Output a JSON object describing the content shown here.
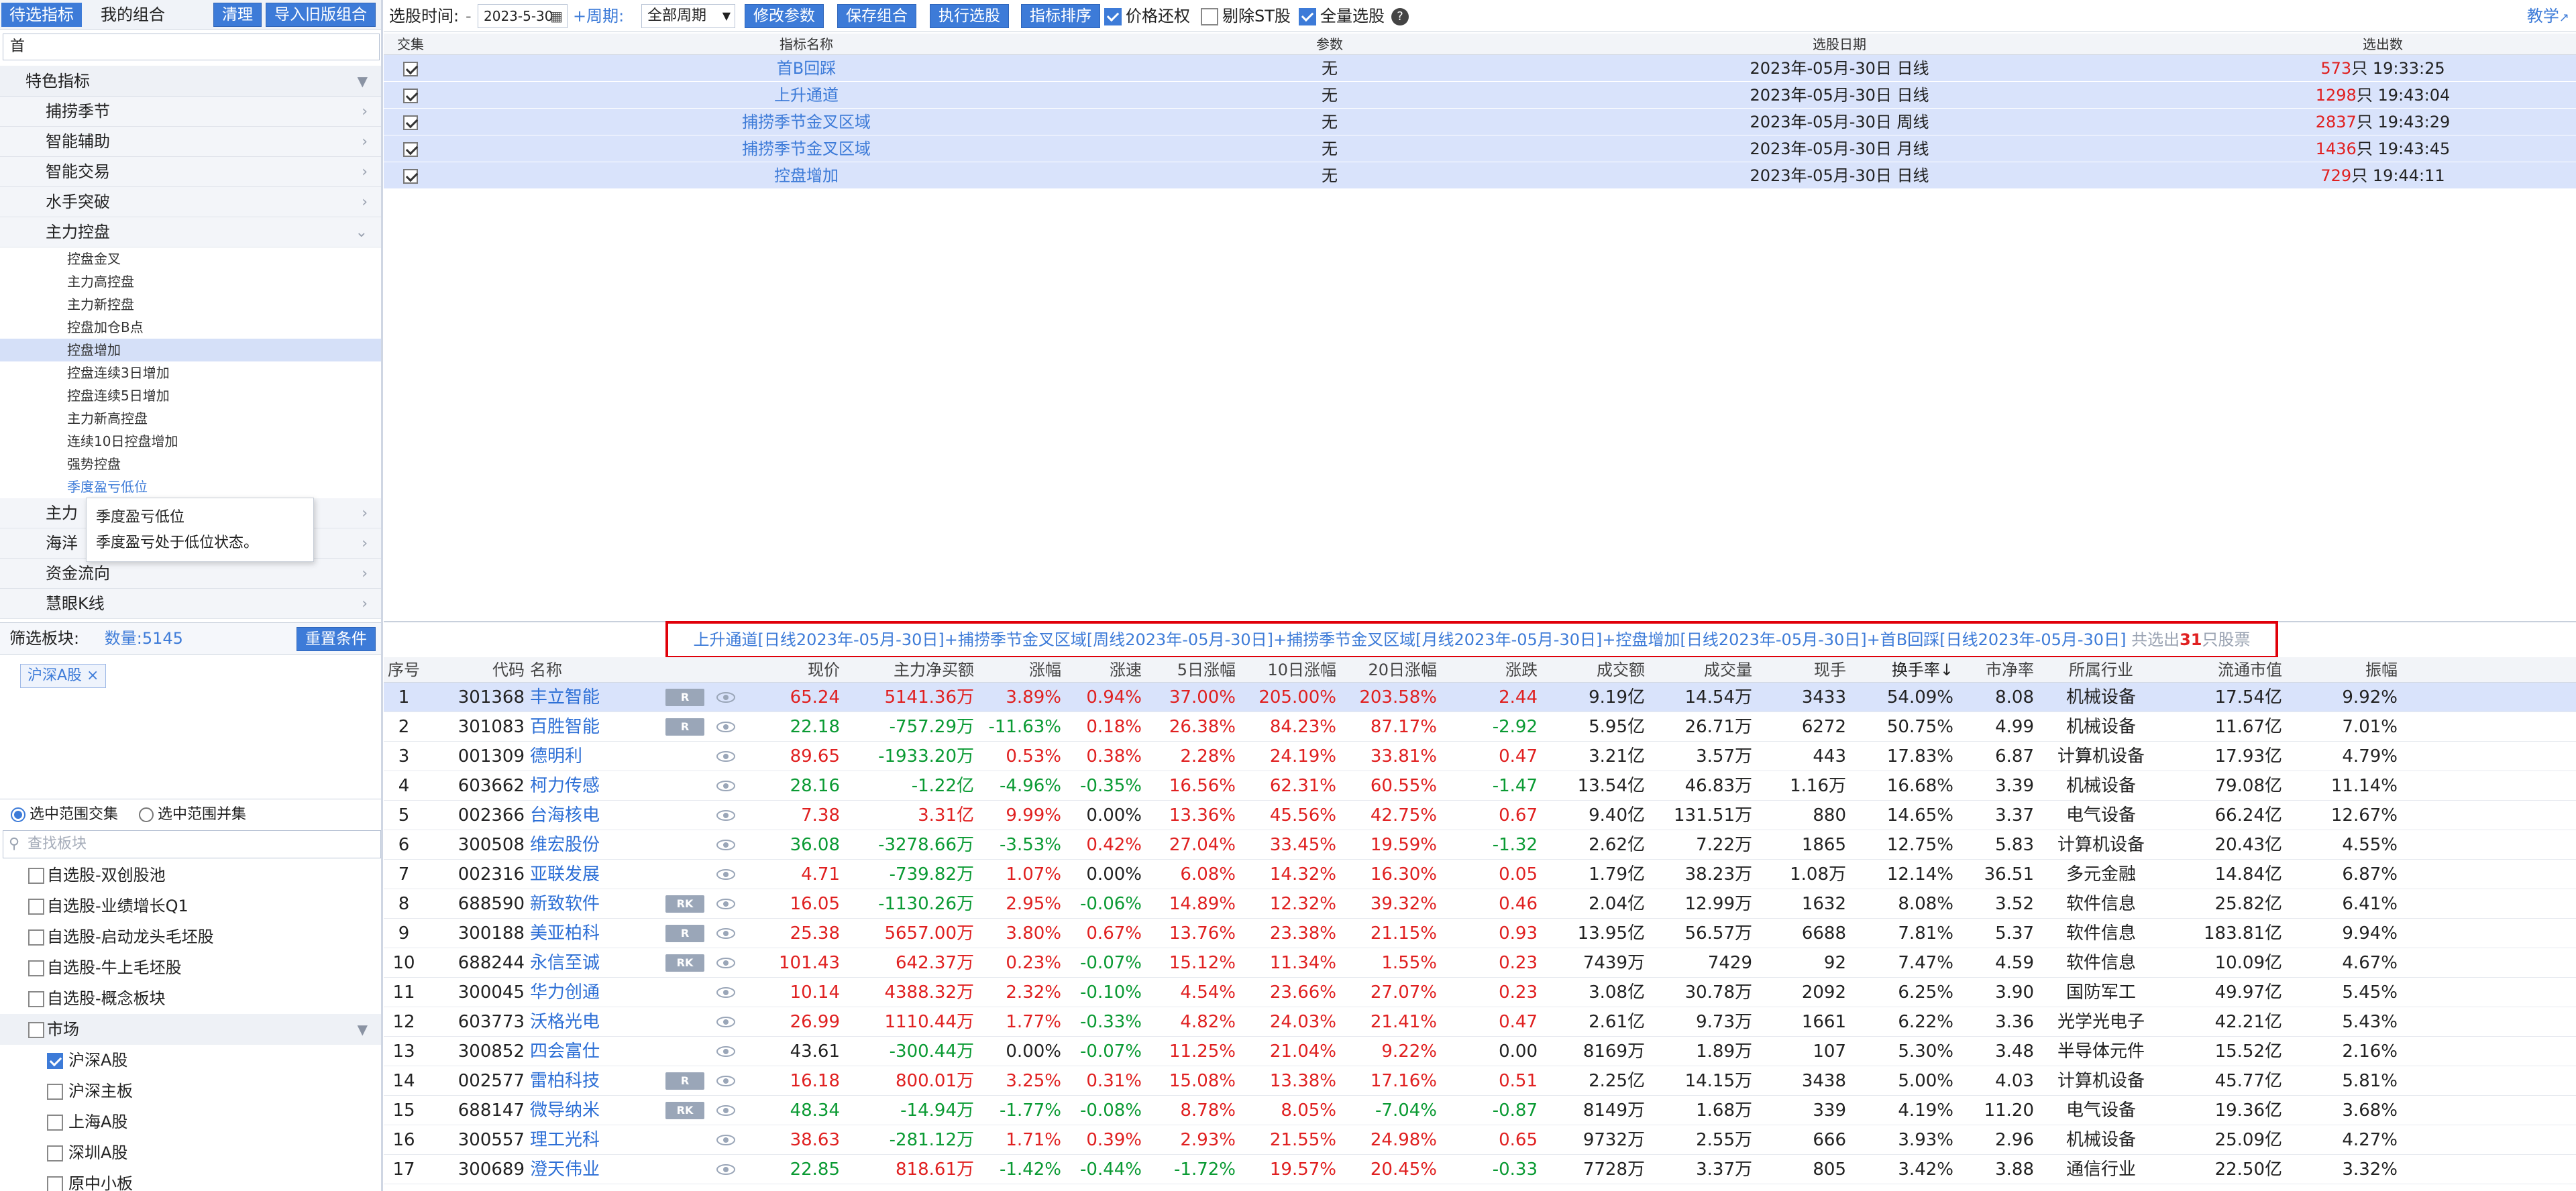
{
  "left": {
    "tabs": [
      "待选指标",
      "我的组合"
    ],
    "buttons": {
      "clear": "清理",
      "import": "导入旧版组合"
    },
    "search_value": "首",
    "tree": [
      {
        "type": "cat",
        "label": "特色指标",
        "arrow": "▼"
      },
      {
        "type": "sub",
        "label": "捕捞季节",
        "arrow": "›"
      },
      {
        "type": "sub",
        "label": "智能辅助",
        "arrow": "›"
      },
      {
        "type": "sub",
        "label": "智能交易",
        "arrow": "›"
      },
      {
        "type": "sub",
        "label": "水手突破",
        "arrow": "›"
      },
      {
        "type": "sub",
        "label": "主力控盘",
        "arrow": "⌄"
      },
      {
        "type": "leaf",
        "label": "控盘金叉"
      },
      {
        "type": "leaf",
        "label": "主力高控盘"
      },
      {
        "type": "leaf",
        "label": "主力新控盘"
      },
      {
        "type": "leaf",
        "label": "控盘加仓B点"
      },
      {
        "type": "leaf",
        "label": "控盘增加",
        "state": "sel"
      },
      {
        "type": "leaf",
        "label": "控盘连续3日增加"
      },
      {
        "type": "leaf",
        "label": "控盘连续5日增加"
      },
      {
        "type": "leaf",
        "label": "主力新高控盘"
      },
      {
        "type": "leaf",
        "label": "连续10日控盘增加"
      },
      {
        "type": "leaf",
        "label": "强势控盘"
      },
      {
        "type": "leaf",
        "label": "季度盈亏低位",
        "state": "hover"
      },
      {
        "type": "sub",
        "label": "主力",
        "arrow": "›"
      },
      {
        "type": "sub",
        "label": "海洋",
        "arrow": "›"
      },
      {
        "type": "sub",
        "label": "资金流向",
        "arrow": "›"
      },
      {
        "type": "sub",
        "label": "慧眼K线",
        "arrow": "›"
      }
    ],
    "tooltip": {
      "title": "季度盈亏低位",
      "desc": "季度盈亏处于低位状态。"
    },
    "filter": {
      "label": "筛选板块:",
      "count": "数量:5145",
      "reset": "重置条件"
    },
    "selected_tag": "沪深A股 ×",
    "radios": {
      "intersect": "选中范围交集",
      "union": "选中范围并集"
    },
    "board_search_placeholder": "查找板块",
    "boards": [
      {
        "type": "item",
        "label": "自选股-双创股池",
        "checked": false
      },
      {
        "type": "item",
        "label": "自选股-业绩增长Q1",
        "checked": false
      },
      {
        "type": "item",
        "label": "自选股-启动龙头毛坯股",
        "checked": false
      },
      {
        "type": "item",
        "label": "自选股-牛上毛坯股",
        "checked": false
      },
      {
        "type": "item",
        "label": "自选股-概念板块",
        "checked": false
      },
      {
        "type": "group",
        "label": "市场",
        "checked": false
      },
      {
        "type": "sub2",
        "label": "沪深A股",
        "checked": true
      },
      {
        "type": "sub2",
        "label": "沪深主板",
        "checked": false
      },
      {
        "type": "sub2",
        "label": "上海A股",
        "checked": false
      },
      {
        "type": "sub2",
        "label": "深圳A股",
        "checked": false
      },
      {
        "type": "sub2",
        "label": "原中小板",
        "checked": false
      }
    ]
  },
  "toolbar": {
    "time_label": "选股时间:",
    "dash": "-",
    "date": "2023-5-30",
    "calendar_icon": "calendar-icon",
    "period_label": "+周期:",
    "period_value": "全部周期",
    "btn_modify": "修改参数",
    "btn_save": "保存组合",
    "btn_run": "执行选股",
    "btn_sort": "指标排序",
    "chk_price": "价格还权",
    "chk_st": "剔除ST股",
    "chk_full": "全量选股",
    "help": "?",
    "teach": "教学"
  },
  "criteria_table": {
    "headers": [
      "交集",
      "指标名称",
      "参数",
      "选股日期",
      "选出数"
    ],
    "rows": [
      {
        "name": "首B回踩",
        "param": "无",
        "date": "2023年-05月-30日 日线",
        "count": "573",
        "suffix": "只 19:33:25"
      },
      {
        "name": "上升通道",
        "param": "无",
        "date": "2023年-05月-30日 日线",
        "count": "1298",
        "suffix": "只 19:43:04"
      },
      {
        "name": "捕捞季节金叉区域",
        "param": "无",
        "date": "2023年-05月-30日 周线",
        "count": "2837",
        "suffix": "只 19:43:29"
      },
      {
        "name": "捕捞季节金叉区域",
        "param": "无",
        "date": "2023年-05月-30日 月线",
        "count": "1436",
        "suffix": "只 19:43:45"
      },
      {
        "name": "控盘增加",
        "param": "无",
        "date": "2023年-05月-30日 日线",
        "count": "729",
        "suffix": "只 19:44:11"
      }
    ]
  },
  "result_bar": {
    "formula": "上升通道[日线2023年-05月-30日]+捕捞季节金叉区域[周线2023年-05月-30日]+捕捞季节金叉区域[月线2023年-05月-30日]+控盘增加[日线2023年-05月-30日]+首B回踩[日线2023年-05月-30日]",
    "prefix": " 共选出",
    "count": "31",
    "suffix": "只股票"
  },
  "stock_table": {
    "headers": [
      "序号",
      "代码",
      "名称",
      "",
      "",
      "现价",
      "主力净买额",
      "涨幅",
      "涨速",
      "5日涨幅",
      "10日涨幅",
      "20日涨幅",
      "涨跌",
      "成交额",
      "成交量",
      "现手",
      "换手率↓",
      "市净率",
      "所属行业",
      "流通市值",
      "振幅"
    ],
    "rows": [
      {
        "no": "1",
        "code": "301368",
        "name": "丰立智能",
        "badge": "R",
        "price": "65.24",
        "pc": "red",
        "net": "5141.36万",
        "nc": "red",
        "chg": "3.89%",
        "cc": "red",
        "speed": "0.94%",
        "sc": "red",
        "d5": "37.00%",
        "d5c": "red",
        "d10": "205.00%",
        "d10c": "red",
        "d20": "203.58%",
        "d20c": "red",
        "diff": "2.44",
        "dc": "red",
        "amount": "9.19亿",
        "vol": "14.54万",
        "hand": "3433",
        "turn": "54.09%",
        "pb": "8.08",
        "ind": "机械设备",
        "mcap": "17.54亿",
        "amp": "9.92%"
      },
      {
        "no": "2",
        "code": "301083",
        "name": "百胜智能",
        "badge": "R",
        "price": "22.18",
        "pc": "green",
        "net": "-757.29万",
        "nc": "green",
        "chg": "-11.63%",
        "cc": "green",
        "speed": "0.18%",
        "sc": "red",
        "d5": "26.38%",
        "d5c": "red",
        "d10": "84.23%",
        "d10c": "red",
        "d20": "87.17%",
        "d20c": "red",
        "diff": "-2.92",
        "dc": "green",
        "amount": "5.95亿",
        "vol": "26.71万",
        "hand": "6272",
        "turn": "50.75%",
        "pb": "4.99",
        "ind": "机械设备",
        "mcap": "11.67亿",
        "amp": "7.01%"
      },
      {
        "no": "3",
        "code": "001309",
        "name": "德明利",
        "badge": "",
        "price": "89.65",
        "pc": "red",
        "net": "-1933.20万",
        "nc": "green",
        "chg": "0.53%",
        "cc": "red",
        "speed": "0.38%",
        "sc": "red",
        "d5": "2.28%",
        "d5c": "red",
        "d10": "24.19%",
        "d10c": "red",
        "d20": "33.81%",
        "d20c": "red",
        "diff": "0.47",
        "dc": "red",
        "amount": "3.21亿",
        "vol": "3.57万",
        "hand": "443",
        "turn": "17.83%",
        "pb": "6.87",
        "ind": "计算机设备",
        "mcap": "17.93亿",
        "amp": "4.79%"
      },
      {
        "no": "4",
        "code": "603662",
        "name": "柯力传感",
        "badge": "",
        "price": "28.16",
        "pc": "green",
        "net": "-1.22亿",
        "nc": "green",
        "chg": "-4.96%",
        "cc": "green",
        "speed": "-0.35%",
        "sc": "green",
        "d5": "16.56%",
        "d5c": "red",
        "d10": "62.31%",
        "d10c": "red",
        "d20": "60.55%",
        "d20c": "red",
        "diff": "-1.47",
        "dc": "green",
        "amount": "13.54亿",
        "vol": "46.83万",
        "hand": "1.16万",
        "turn": "16.68%",
        "pb": "3.39",
        "ind": "机械设备",
        "mcap": "79.08亿",
        "amp": "11.14%"
      },
      {
        "no": "5",
        "code": "002366",
        "name": "台海核电",
        "badge": "",
        "price": "7.38",
        "pc": "red",
        "net": "3.31亿",
        "nc": "red",
        "chg": "9.99%",
        "cc": "red",
        "speed": "0.00%",
        "sc": "",
        "d5": "13.36%",
        "d5c": "red",
        "d10": "45.56%",
        "d10c": "red",
        "d20": "42.75%",
        "d20c": "red",
        "diff": "0.67",
        "dc": "red",
        "amount": "9.40亿",
        "vol": "131.51万",
        "hand": "880",
        "turn": "14.65%",
        "pb": "3.37",
        "ind": "电气设备",
        "mcap": "66.24亿",
        "amp": "12.67%"
      },
      {
        "no": "6",
        "code": "300508",
        "name": "维宏股份",
        "badge": "",
        "price": "36.08",
        "pc": "green",
        "net": "-3278.66万",
        "nc": "green",
        "chg": "-3.53%",
        "cc": "green",
        "speed": "0.42%",
        "sc": "red",
        "d5": "27.04%",
        "d5c": "red",
        "d10": "33.45%",
        "d10c": "red",
        "d20": "19.59%",
        "d20c": "red",
        "diff": "-1.32",
        "dc": "green",
        "amount": "2.62亿",
        "vol": "7.22万",
        "hand": "1865",
        "turn": "12.75%",
        "pb": "5.83",
        "ind": "计算机设备",
        "mcap": "20.43亿",
        "amp": "4.55%"
      },
      {
        "no": "7",
        "code": "002316",
        "name": "亚联发展",
        "badge": "",
        "price": "4.71",
        "pc": "red",
        "net": "-739.82万",
        "nc": "green",
        "chg": "1.07%",
        "cc": "red",
        "speed": "0.00%",
        "sc": "",
        "d5": "6.08%",
        "d5c": "red",
        "d10": "14.32%",
        "d10c": "red",
        "d20": "16.30%",
        "d20c": "red",
        "diff": "0.05",
        "dc": "red",
        "amount": "1.79亿",
        "vol": "38.23万",
        "hand": "1.08万",
        "turn": "12.14%",
        "pb": "36.51",
        "ind": "多元金融",
        "mcap": "14.84亿",
        "amp": "6.87%"
      },
      {
        "no": "8",
        "code": "688590",
        "name": "新致软件",
        "badge": "RK",
        "price": "16.05",
        "pc": "red",
        "net": "-1130.26万",
        "nc": "green",
        "chg": "2.95%",
        "cc": "red",
        "speed": "-0.06%",
        "sc": "green",
        "d5": "14.89%",
        "d5c": "red",
        "d10": "12.32%",
        "d10c": "red",
        "d20": "39.32%",
        "d20c": "red",
        "diff": "0.46",
        "dc": "red",
        "amount": "2.04亿",
        "vol": "12.99万",
        "hand": "1632",
        "turn": "8.08%",
        "pb": "3.52",
        "ind": "软件信息",
        "mcap": "25.82亿",
        "amp": "6.41%"
      },
      {
        "no": "9",
        "code": "300188",
        "name": "美亚柏科",
        "badge": "R",
        "price": "25.38",
        "pc": "red",
        "net": "5657.00万",
        "nc": "red",
        "chg": "3.80%",
        "cc": "red",
        "speed": "0.67%",
        "sc": "red",
        "d5": "13.76%",
        "d5c": "red",
        "d10": "23.38%",
        "d10c": "red",
        "d20": "21.15%",
        "d20c": "red",
        "diff": "0.93",
        "dc": "red",
        "amount": "13.95亿",
        "vol": "56.57万",
        "hand": "6688",
        "turn": "7.81%",
        "pb": "5.37",
        "ind": "软件信息",
        "mcap": "183.81亿",
        "amp": "9.94%"
      },
      {
        "no": "10",
        "code": "688244",
        "name": "永信至诚",
        "badge": "RK",
        "price": "101.43",
        "pc": "red",
        "net": "642.37万",
        "nc": "red",
        "chg": "0.23%",
        "cc": "red",
        "speed": "-0.07%",
        "sc": "green",
        "d5": "15.12%",
        "d5c": "red",
        "d10": "11.34%",
        "d10c": "red",
        "d20": "1.55%",
        "d20c": "red",
        "diff": "0.23",
        "dc": "red",
        "amount": "7439万",
        "vol": "7429",
        "hand": "92",
        "turn": "7.47%",
        "pb": "4.59",
        "ind": "软件信息",
        "mcap": "10.09亿",
        "amp": "4.67%"
      },
      {
        "no": "11",
        "code": "300045",
        "name": "华力创通",
        "badge": "",
        "price": "10.14",
        "pc": "red",
        "net": "4388.32万",
        "nc": "red",
        "chg": "2.32%",
        "cc": "red",
        "speed": "-0.10%",
        "sc": "green",
        "d5": "4.54%",
        "d5c": "red",
        "d10": "23.66%",
        "d10c": "red",
        "d20": "27.07%",
        "d20c": "red",
        "diff": "0.23",
        "dc": "red",
        "amount": "3.08亿",
        "vol": "30.78万",
        "hand": "2092",
        "turn": "6.25%",
        "pb": "3.90",
        "ind": "国防军工",
        "mcap": "49.97亿",
        "amp": "5.45%"
      },
      {
        "no": "12",
        "code": "603773",
        "name": "沃格光电",
        "badge": "",
        "price": "26.99",
        "pc": "red",
        "net": "1110.44万",
        "nc": "red",
        "chg": "1.77%",
        "cc": "red",
        "speed": "-0.33%",
        "sc": "green",
        "d5": "4.82%",
        "d5c": "red",
        "d10": "24.03%",
        "d10c": "red",
        "d20": "21.41%",
        "d20c": "red",
        "diff": "0.47",
        "dc": "red",
        "amount": "2.61亿",
        "vol": "9.73万",
        "hand": "1661",
        "turn": "6.22%",
        "pb": "3.36",
        "ind": "光学光电子",
        "mcap": "42.21亿",
        "amp": "5.43%"
      },
      {
        "no": "13",
        "code": "300852",
        "name": "四会富仕",
        "badge": "",
        "price": "43.61",
        "pc": "",
        "net": "-300.44万",
        "nc": "green",
        "chg": "0.00%",
        "cc": "",
        "speed": "-0.07%",
        "sc": "green",
        "d5": "11.25%",
        "d5c": "red",
        "d10": "21.04%",
        "d10c": "red",
        "d20": "9.22%",
        "d20c": "red",
        "diff": "0.00",
        "dc": "",
        "amount": "8169万",
        "vol": "1.89万",
        "hand": "107",
        "turn": "5.30%",
        "pb": "3.48",
        "ind": "半导体元件",
        "mcap": "15.52亿",
        "amp": "2.16%"
      },
      {
        "no": "14",
        "code": "002577",
        "name": "雷柏科技",
        "badge": "R",
        "price": "16.18",
        "pc": "red",
        "net": "800.01万",
        "nc": "red",
        "chg": "3.25%",
        "cc": "red",
        "speed": "0.31%",
        "sc": "red",
        "d5": "15.08%",
        "d5c": "red",
        "d10": "13.38%",
        "d10c": "red",
        "d20": "17.16%",
        "d20c": "red",
        "diff": "0.51",
        "dc": "red",
        "amount": "2.25亿",
        "vol": "14.15万",
        "hand": "3438",
        "turn": "5.00%",
        "pb": "4.03",
        "ind": "计算机设备",
        "mcap": "45.77亿",
        "amp": "5.81%"
      },
      {
        "no": "15",
        "code": "688147",
        "name": "微导纳米",
        "badge": "RK",
        "price": "48.34",
        "pc": "green",
        "net": "-14.94万",
        "nc": "green",
        "chg": "-1.77%",
        "cc": "green",
        "speed": "-0.08%",
        "sc": "green",
        "d5": "8.78%",
        "d5c": "red",
        "d10": "8.05%",
        "d10c": "red",
        "d20": "-7.04%",
        "d20c": "green",
        "diff": "-0.87",
        "dc": "green",
        "amount": "8149万",
        "vol": "1.68万",
        "hand": "339",
        "turn": "4.19%",
        "pb": "11.20",
        "ind": "电气设备",
        "mcap": "19.36亿",
        "amp": "3.68%"
      },
      {
        "no": "16",
        "code": "300557",
        "name": "理工光科",
        "badge": "",
        "price": "38.63",
        "pc": "red",
        "net": "-281.12万",
        "nc": "green",
        "chg": "1.71%",
        "cc": "red",
        "speed": "0.39%",
        "sc": "red",
        "d5": "2.93%",
        "d5c": "red",
        "d10": "21.55%",
        "d10c": "red",
        "d20": "24.98%",
        "d20c": "red",
        "diff": "0.65",
        "dc": "red",
        "amount": "9732万",
        "vol": "2.55万",
        "hand": "666",
        "turn": "3.93%",
        "pb": "2.96",
        "ind": "机械设备",
        "mcap": "25.09亿",
        "amp": "4.27%"
      },
      {
        "no": "17",
        "code": "300689",
        "name": "澄天伟业",
        "badge": "",
        "price": "22.85",
        "pc": "green",
        "net": "818.61万",
        "nc": "red",
        "chg": "-1.42%",
        "cc": "green",
        "speed": "-0.44%",
        "sc": "green",
        "d5": "-1.72%",
        "d5c": "green",
        "d10": "19.57%",
        "d10c": "red",
        "d20": "20.45%",
        "d20c": "red",
        "diff": "-0.33",
        "dc": "green",
        "amount": "7728万",
        "vol": "3.37万",
        "hand": "805",
        "turn": "3.42%",
        "pb": "3.88",
        "ind": "通信行业",
        "mcap": "22.50亿",
        "amp": "3.32%"
      }
    ]
  }
}
